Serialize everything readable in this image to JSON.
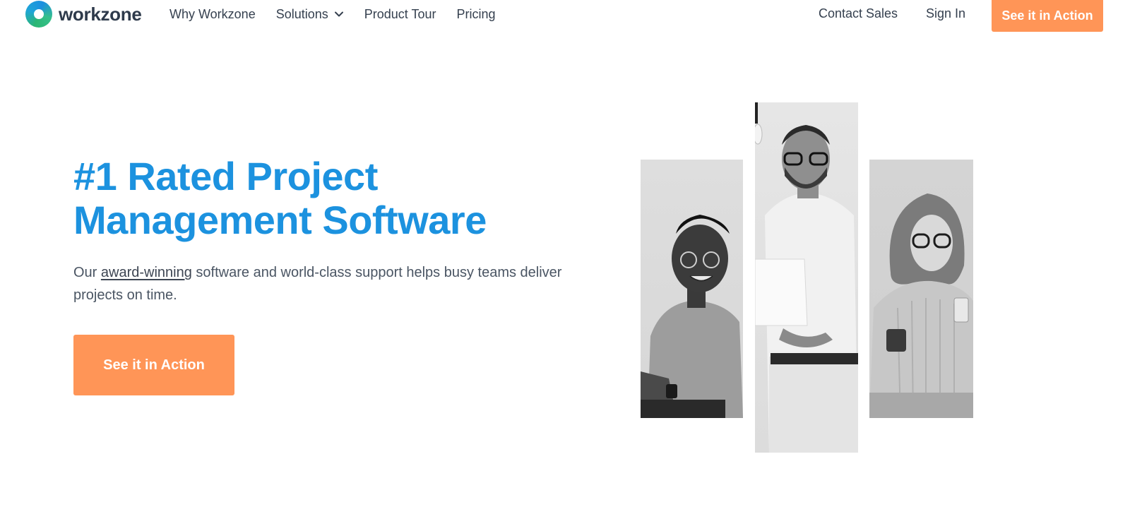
{
  "brand": {
    "name": "workzone",
    "logo_icon": "workzone-ring-logo"
  },
  "nav": {
    "links": [
      {
        "label": "Why Workzone"
      },
      {
        "label": "Solutions",
        "icon": "chevron-down-icon"
      },
      {
        "label": "Product Tour"
      },
      {
        "label": "Pricing"
      }
    ],
    "contact": "Contact Sales",
    "signin": "Sign In",
    "cta": "See it in Action"
  },
  "hero": {
    "title_strong": "#1 Rated",
    "title_rest": " Project",
    "title_line2": "Management Software",
    "subtitle_prefix": "Our ",
    "subtitle_link": "award-winning",
    "subtitle_suffix": " software and world-class support helps busy teams deliver projects on time.",
    "cta": "See it in Action"
  },
  "photos": [
    {
      "subject": "man-laughing-at-laptop"
    },
    {
      "subject": "man-with-laptop-standing"
    },
    {
      "subject": "woman-with-phone-and-mug"
    }
  ],
  "colors": {
    "accent_blue": "#1c92df",
    "cta_orange": "#ff9557",
    "text_dark": "#35404f"
  }
}
